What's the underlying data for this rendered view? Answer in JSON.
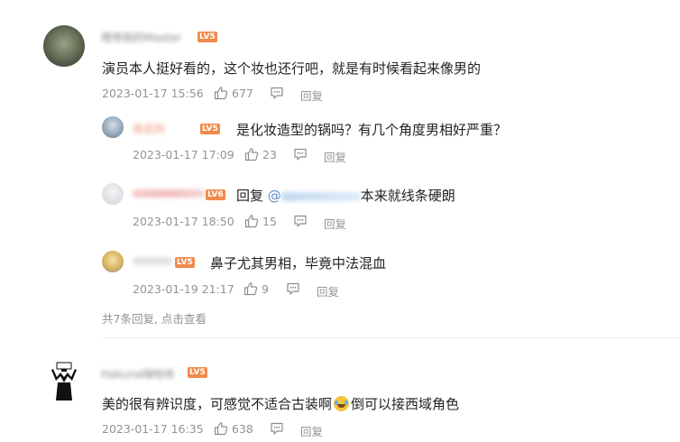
{
  "comments": [
    {
      "username": "喂帝刚的Master",
      "level": "LV5",
      "text": "演员本人挺好看的，这个妆也还行吧，就是有时候看起来像男的",
      "time": "2023-01-17 15:56",
      "likes": "677",
      "reply_label": "回复",
      "replies": [
        {
          "username": "南昌狗",
          "level": "LV5",
          "text": "是化妆造型的锅吗？有几个角度男相好严重？",
          "time": "2023-01-17 17:09",
          "likes": "23",
          "reply_label": "回复"
        },
        {
          "username": "",
          "level": "LV6",
          "text_prefix": "回复",
          "mention": "@",
          "text": "本来就线条硬朗",
          "time": "2023-01-17 18:50",
          "likes": "15",
          "reply_label": "回复"
        },
        {
          "username": "",
          "level": "LV5",
          "text": "鼻子尤其男相，毕竟中法混血",
          "time": "2023-01-19 21:17",
          "likes": "9",
          "reply_label": "回复"
        }
      ],
      "more_replies": "共7条回复, 点击查看"
    },
    {
      "username": "Hakuna嗨哈哈",
      "level": "LV5",
      "text_part1": "美的很有辨识度，可感觉不适合古装啊",
      "emoji": "face-with-tears-of-joy",
      "text_part2": "倒可以接西域角色",
      "time": "2023-01-17 16:35",
      "likes": "638",
      "reply_label": "回复"
    }
  ],
  "colors": {
    "username": "#eb7350",
    "meta": "#939393",
    "level_badge": "#f08a4b",
    "divider": "#ececec"
  }
}
